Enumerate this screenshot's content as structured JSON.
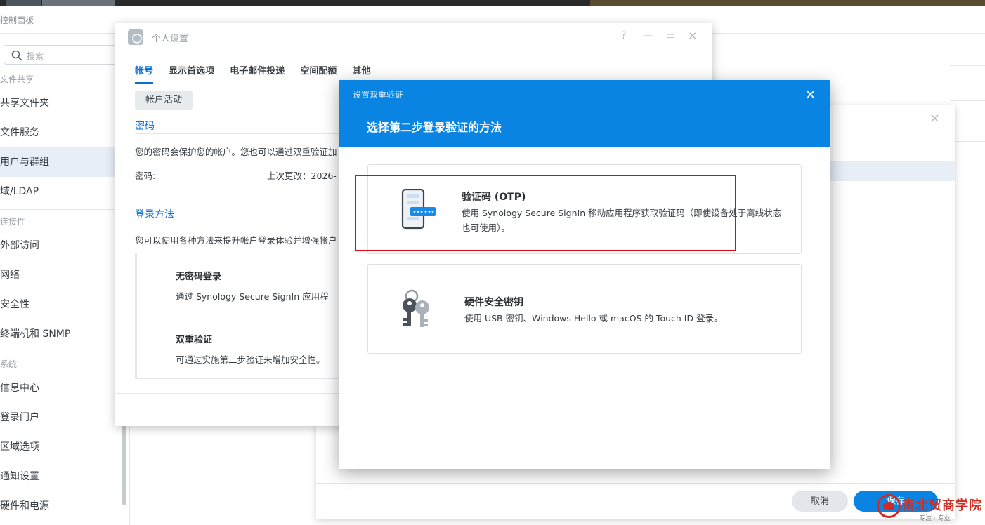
{
  "control_panel": {
    "title": "控制面板",
    "search_placeholder": "搜索",
    "sidebar": [
      {
        "type": "group",
        "label": "文件共享"
      },
      {
        "type": "item",
        "label": "共享文件夹"
      },
      {
        "type": "item",
        "label": "文件服务"
      },
      {
        "type": "item",
        "label": "用户与群组",
        "active": true
      },
      {
        "type": "item",
        "label": "域/LDAP"
      },
      {
        "type": "group",
        "label": "连接性"
      },
      {
        "type": "item",
        "label": "外部访问"
      },
      {
        "type": "item",
        "label": "网络"
      },
      {
        "type": "item",
        "label": "安全性"
      },
      {
        "type": "item",
        "label": "终端机和 SNMP"
      },
      {
        "type": "group",
        "label": "系统"
      },
      {
        "type": "item",
        "label": "信息中心"
      },
      {
        "type": "item",
        "label": "登录门户"
      },
      {
        "type": "item",
        "label": "区域选项"
      },
      {
        "type": "item",
        "label": "通知设置"
      },
      {
        "type": "item",
        "label": "硬件和电源"
      }
    ]
  },
  "background_window": {
    "close_label": "×",
    "cancel_label": "取消",
    "save_label": "保存"
  },
  "personal_window": {
    "title": "个人设置",
    "help_label": "?",
    "minimize_label": "—",
    "maximize_label": "▭",
    "close_label": "×",
    "tabs": [
      "帐号",
      "显示首选项",
      "电子邮件投递",
      "空间配额",
      "其他"
    ],
    "account_activity_button": "帐户活动",
    "password_section": {
      "title": "密码",
      "description": "您的密码会保护您的帐户。您也可以通过双重验证加",
      "label": "密码:",
      "last_changed": "上次更改：2026-"
    },
    "login_section": {
      "title": "登录方法",
      "description": "您可以使用各种方法来提升帐户登录体验并增强帐户"
    },
    "cards": [
      {
        "title": "无密码登录",
        "desc": "通过 Synology Secure SignIn 应用程"
      },
      {
        "title": "双重验证",
        "desc": "可通过实施第二步验证来增加安全性。"
      }
    ]
  },
  "modal": {
    "small_title": "设置双重验证",
    "close_label": "×",
    "heading": "选择第二步登录验证的方法",
    "options": [
      {
        "title": "验证码 (OTP)",
        "desc": "使用 Synology Secure SignIn 移动应用程序获取验证码（即使设备处于离线状态也可使用）。",
        "icon": "phone-otp-icon"
      },
      {
        "title": "硬件安全密钥",
        "desc": "使用 USB 密钥、Windows Hello 或 macOS 的 Touch ID 登录。",
        "icon": "keys-icon"
      }
    ]
  },
  "watermark": {
    "text": "南北贸商学院",
    "sub": "专注 · 专业"
  },
  "colors": {
    "accent": "#0a84e3",
    "link": "#0a6fd1",
    "highlight_box": "#e30613"
  }
}
